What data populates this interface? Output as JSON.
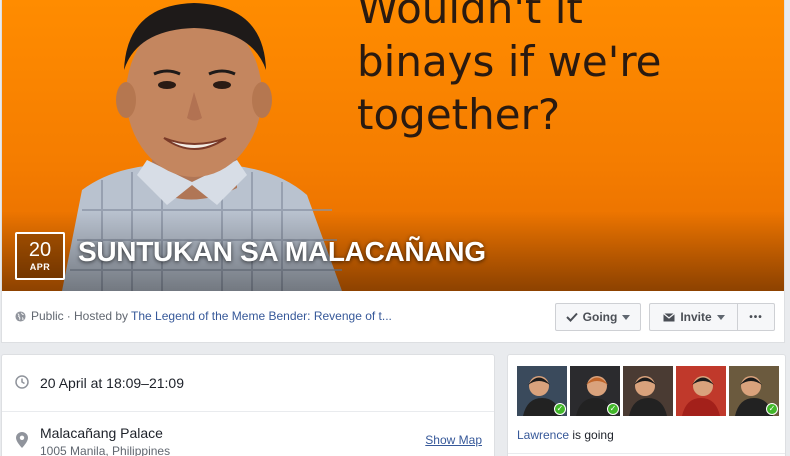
{
  "cover": {
    "caption": "Wouldn't it\nbinays if we're\ntogether?"
  },
  "event": {
    "date_day": "20",
    "date_month": "APR",
    "title": "SUNTUKAN SA MALACAÑANG"
  },
  "meta": {
    "privacy": "Public",
    "hosted_by_prefix": "· Hosted by",
    "host_name": "The Legend of the Meme Bender: Revenge of t..."
  },
  "actions": {
    "going_label": "Going",
    "invite_label": "Invite",
    "more_label": "•••"
  },
  "details": {
    "time": "20 April at 18:09–21:09",
    "place_name": "Malacañang Palace",
    "place_address": "1005 Manila, Philippines",
    "show_map_label": "Show Map"
  },
  "guests": {
    "avatars": [
      {
        "name": "guest-avatar-1",
        "going": true,
        "bg": "#3a4a5c"
      },
      {
        "name": "guest-avatar-2",
        "going": true,
        "bg": "#2b2b2e"
      },
      {
        "name": "guest-avatar-3",
        "going": false,
        "bg": "#4a3b33"
      },
      {
        "name": "guest-avatar-4",
        "going": false,
        "bg": "#c0392b"
      },
      {
        "name": "guest-avatar-5",
        "going": true,
        "bg": "#6b5a3e"
      }
    ],
    "going_name": "Lawrence",
    "going_suffix": "is going"
  },
  "colors": {
    "link": "#365899",
    "cover_orange": "#ff8c00",
    "going_check": "#42b72a"
  }
}
